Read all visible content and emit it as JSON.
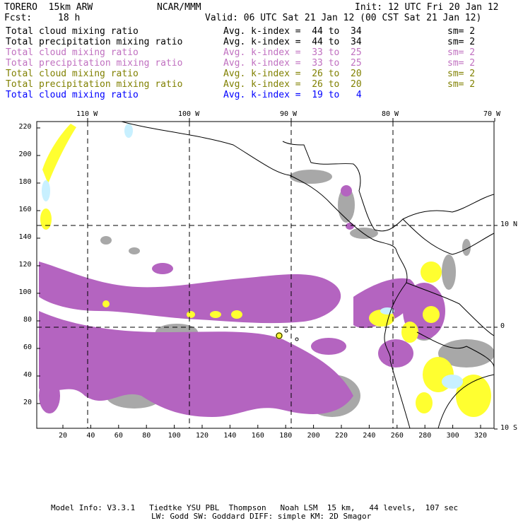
{
  "header": {
    "model": "TORERO  15km ARW",
    "org": "NCAR/MMM",
    "init": "Init: 12 UTC Fri 20 Jan 12",
    "fcst_label": "Fcst:",
    "fcst_value": "18 h",
    "valid": "Valid: 06 UTC Sat 21 Jan 12 (00 CST Sat 21 Jan 12)"
  },
  "legend": [
    {
      "field": "Total cloud mixing ratio",
      "range": "Avg. k-index =  44 to  34",
      "sm": "sm= 2",
      "color": "#000000"
    },
    {
      "field": "Total precipitation mixing ratio",
      "range": "Avg. k-index =  44 to  34",
      "sm": "sm= 2",
      "color": "#000000"
    },
    {
      "field": "Total cloud mixing ratio",
      "range": "Avg. k-index =  33 to  25",
      "sm": "sm= 2",
      "color": "#c070c0"
    },
    {
      "field": "Total precipitation mixing ratio",
      "range": "Avg. k-index =  33 to  25",
      "sm": "sm= 2",
      "color": "#c070c0"
    },
    {
      "field": "Total cloud mixing ratio",
      "range": "Avg. k-index =  26 to  20",
      "sm": "sm= 2",
      "color": "#808000"
    },
    {
      "field": "Total precipitation mixing ratio",
      "range": "Avg. k-index =  26 to  20",
      "sm": "sm= 2",
      "color": "#808000"
    },
    {
      "field": "Total cloud mixing ratio",
      "range": "Avg. k-index =  19 to   4",
      "color": "#0000ff"
    }
  ],
  "map": {
    "lon_labels": [
      "110 W",
      "100 W",
      "90 W",
      "80 W",
      "70 W"
    ],
    "lat_labels": [
      "10 N",
      "0",
      "10 S"
    ],
    "x_ticks": [
      "20",
      "40",
      "60",
      "80",
      "100",
      "120",
      "140",
      "160",
      "180",
      "200",
      "220",
      "240",
      "260",
      "280",
      "300",
      "320"
    ],
    "y_ticks": [
      "20",
      "40",
      "60",
      "80",
      "100",
      "120",
      "140",
      "160",
      "180",
      "200",
      "220"
    ]
  },
  "footer": {
    "line1": "Model Info: V3.3.1   Tiedtke YSU PBL  Thompson   Noah LSM  15 km,   44 levels,  107 sec",
    "line2": "LW: Godd SW: Goddard DIFF: simple KM: 2D Smagor"
  }
}
